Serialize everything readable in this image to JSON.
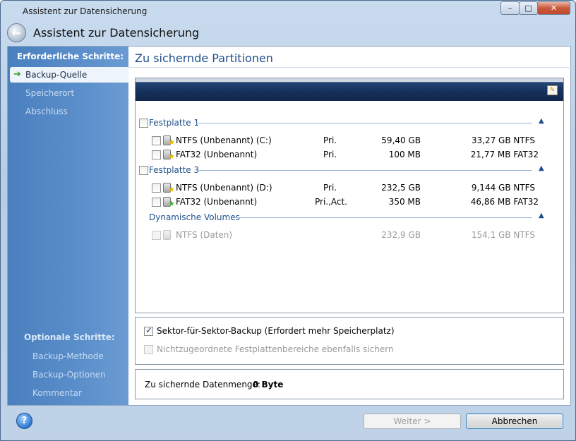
{
  "window": {
    "title": "Assistent zur Datensicherung",
    "controls": {
      "minimize": "–",
      "maximize": "□",
      "close": "✕"
    }
  },
  "header": {
    "title": "Assistent zur Datensicherung"
  },
  "sidebar": {
    "required_heading": "Erforderliche Schritte:",
    "required_items": [
      {
        "label": "Backup-Quelle",
        "active": true
      },
      {
        "label": "Speicherort",
        "active": false
      },
      {
        "label": "Abschluss",
        "active": false
      }
    ],
    "optional_heading": "Optionale Schritte:",
    "optional_items": [
      {
        "label": "Backup-Methode"
      },
      {
        "label": "Backup-Optionen"
      },
      {
        "label": "Kommentar"
      }
    ]
  },
  "main": {
    "page_title": "Zu sichernde Partitionen",
    "groups": [
      {
        "label": "Festplatte 1",
        "partitions": [
          {
            "name": "NTFS (Unbenannt) (C:)",
            "type": "Pri.",
            "size": "59,40 GB",
            "free": "33,27 GB NTFS",
            "icon": "disk-yellow-star",
            "enabled": true
          },
          {
            "name": "FAT32 (Unbenannt)",
            "type": "Pri.",
            "size": "100 MB",
            "free": "21,77 MB FAT32",
            "icon": "disk-yellow-star",
            "enabled": true
          }
        ]
      },
      {
        "label": "Festplatte 3",
        "partitions": [
          {
            "name": "NTFS (Unbenannt) (D:)",
            "type": "Pri.",
            "size": "232,5 GB",
            "free": "9,144 GB NTFS",
            "icon": "disk-yellow-star",
            "enabled": true
          },
          {
            "name": "FAT32 (Unbenannt)",
            "type": "Pri.,Act.",
            "size": "350 MB",
            "free": "46,86 MB FAT32",
            "icon": "disk-green-star",
            "enabled": true
          }
        ]
      },
      {
        "label": "Dynamische Volumes",
        "partitions": [
          {
            "name": "NTFS (Daten)",
            "type": "",
            "size": "232,9 GB",
            "free": "154,1 GB NTFS",
            "icon": "disk-disabled",
            "enabled": false
          }
        ]
      }
    ],
    "options": {
      "sector_backup_label": "Sektor-für-Sektor-Backup (Erfordert mehr Speicherplatz)",
      "sector_backup_checked": true,
      "unallocated_label": "Nichtzugeordnete Festplattenbereiche ebenfalls sichern",
      "unallocated_checked": false
    },
    "data_size": {
      "label": "Zu sichernde Datenmenge:",
      "value": "0 Byte"
    }
  },
  "footer": {
    "next_label": "Weiter >",
    "cancel_label": "Abbrechen"
  }
}
